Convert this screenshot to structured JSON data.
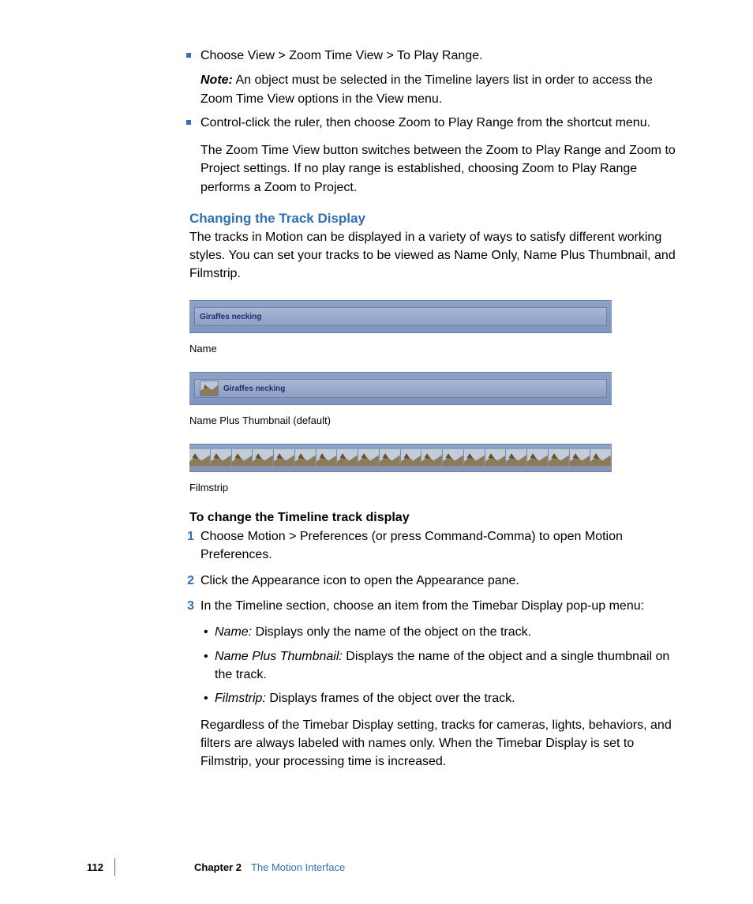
{
  "colors": {
    "accent": "#2f6fb4",
    "bullet": "#3b6fb4",
    "track_text": "#1e2e6f"
  },
  "bullet1": {
    "text": "Choose View > Zoom Time View > To Play Range.",
    "note_label": "Note:",
    "note_text": "  An object must be selected in the Timeline layers list in order to access the Zoom Time View options in the View menu."
  },
  "bullet2": {
    "text": "Control-click the ruler, then choose Zoom to Play Range from the shortcut menu.",
    "follow": "The Zoom Time View button switches between the Zoom to Play Range and Zoom to Project settings. If no play range is established, choosing Zoom to Play Range performs a Zoom to Project."
  },
  "section": {
    "heading": "Changing the Track Display",
    "intro": "The tracks in Motion can be displayed in a variety of ways to satisfy different working styles. You can set your tracks to be viewed as Name Only, Name Plus Thumbnail, and Filmstrip."
  },
  "tracks": {
    "clip_name": "Giraffes necking",
    "caption1": "Name",
    "caption2": "Name Plus Thumbnail (default)",
    "caption3": "Filmstrip"
  },
  "procedure": {
    "heading": "To change the Timeline track display",
    "steps": [
      "Choose Motion > Preferences (or press Command-Comma) to open Motion Preferences.",
      "Click the Appearance icon to open the Appearance pane.",
      "In the Timeline section, choose an item from the Timebar Display pop-up menu:"
    ],
    "options": [
      {
        "term": "Name:",
        "desc": "  Displays only the name of the object on the track."
      },
      {
        "term": "Name Plus Thumbnail:",
        "desc": "  Displays the name of the object and a single thumbnail on the track."
      },
      {
        "term": "Filmstrip:",
        "desc": "  Displays frames of the object over the track."
      }
    ],
    "closing": "Regardless of the Timebar Display setting, tracks for cameras, lights, behaviors, and filters are always labeled with names only. When the Timebar Display is set to Filmstrip, your processing time is increased."
  },
  "footer": {
    "page": "112",
    "chapter": "Chapter 2",
    "title": "The Motion Interface"
  }
}
